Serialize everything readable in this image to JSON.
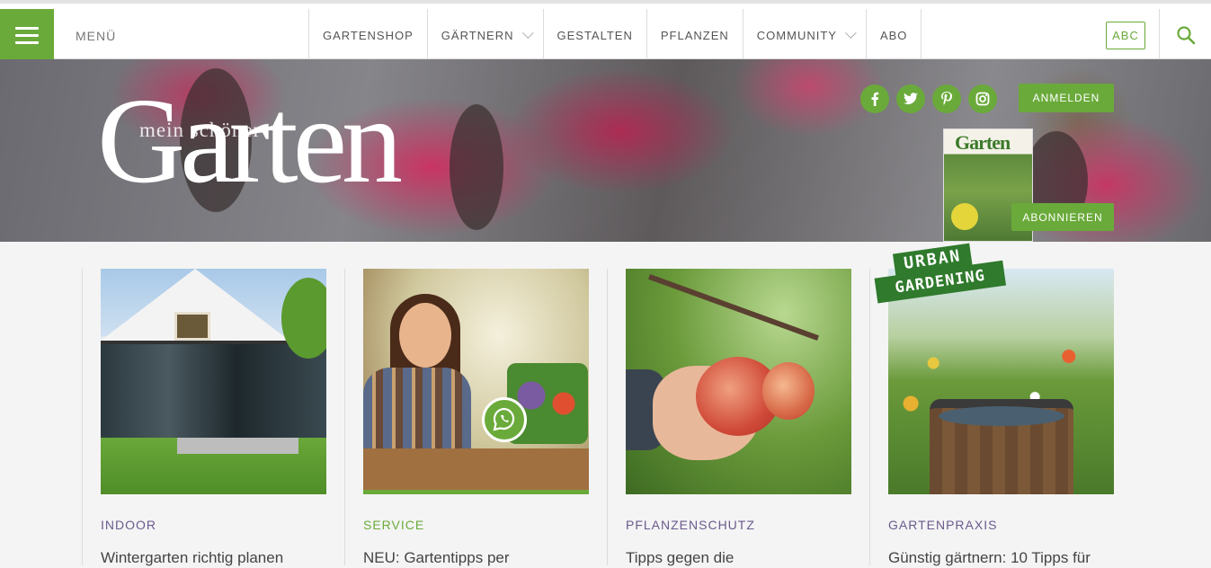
{
  "nav": {
    "menu_label": "MENÜ",
    "items": [
      {
        "label": "GARTENSHOP",
        "has_dropdown": false
      },
      {
        "label": "GÄRTNERN",
        "has_dropdown": true
      },
      {
        "label": "GESTALTEN",
        "has_dropdown": false
      },
      {
        "label": "PFLANZEN",
        "has_dropdown": false
      },
      {
        "label": "COMMUNITY",
        "has_dropdown": true
      },
      {
        "label": "ABO",
        "has_dropdown": false
      }
    ],
    "abc_label": "ABC",
    "search_icon": "search-icon",
    "accent_color": "#6aaa3a"
  },
  "hero": {
    "logo_small": "mein schöner",
    "logo_big": "Garten",
    "socials": [
      "facebook-icon",
      "twitter-icon",
      "pinterest-icon",
      "instagram-icon"
    ],
    "login_label": "ANMELDEN",
    "subscribe_label": "ABONNIEREN",
    "magazine_title": "Garten"
  },
  "cards": [
    {
      "category": "INDOOR",
      "category_color": "#6b5a8e",
      "title": "Wintergarten richtig planen"
    },
    {
      "category": "SERVICE",
      "category_color": "#6aaa3a",
      "title": "NEU: Gartentipps per"
    },
    {
      "category": "PFLANZENSCHUTZ",
      "category_color": "#6b5a8e",
      "title": "Tipps gegen die"
    },
    {
      "category": "GARTENPRAXIS",
      "category_color": "#6b5a8e",
      "title": "Günstig gärtnern: 10 Tipps für",
      "badge": [
        "URBAN",
        "GARDENING"
      ]
    }
  ]
}
